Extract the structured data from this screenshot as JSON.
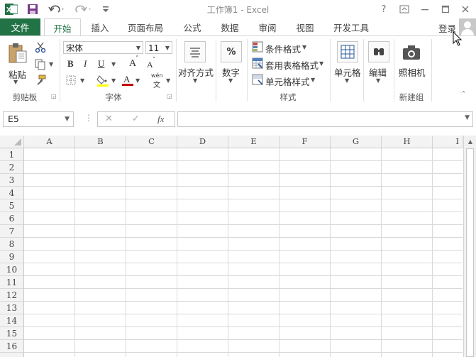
{
  "app": {
    "title": "工作簿1 - Excel",
    "icon": "excel-icon"
  },
  "quick_access": {
    "save_icon": "save-icon",
    "undo_icon": "undo-icon",
    "redo_icon": "redo-icon",
    "customize_icon": "customize-icon"
  },
  "window_controls": {
    "help": "?",
    "ribbon_display_icon": "ribbon-display-icon",
    "minimize_icon": "minimize-icon",
    "maximize_icon": "maximize-icon",
    "close_icon": "close-icon"
  },
  "tabs": {
    "file": "文件",
    "items": [
      "开始",
      "插入",
      "页面布局",
      "公式",
      "数据",
      "审阅",
      "视图",
      "开发工具"
    ],
    "active": "开始",
    "login": "登录"
  },
  "ribbon": {
    "clipboard": {
      "label": "剪贴板",
      "paste": "粘贴"
    },
    "font": {
      "label": "字体",
      "font_name": "宋体",
      "font_size": "11",
      "bold": "B",
      "italic": "I",
      "underline": "U",
      "grow": "A",
      "shrink": "A",
      "phonetic_top": "wén",
      "phonetic_bottom": "文"
    },
    "alignment": {
      "label": "对齐方式"
    },
    "number": {
      "label": "数字",
      "symbol": "%"
    },
    "styles": {
      "label": "样式",
      "conditional": "条件格式",
      "table_format": "套用表格格式",
      "cell_styles": "单元格样式"
    },
    "cells": {
      "label": "单元格"
    },
    "editing": {
      "label": "编辑"
    },
    "camera": {
      "label": "照相机",
      "group": "新建组"
    }
  },
  "formula_bar": {
    "name_box": "E5",
    "cancel": "✕",
    "enter": "✓",
    "fx": "fx",
    "value": ""
  },
  "sheet": {
    "columns": [
      "A",
      "B",
      "C",
      "D",
      "E",
      "F",
      "G",
      "H",
      "I"
    ],
    "rows": [
      "1",
      "2",
      "3",
      "4",
      "5",
      "6",
      "7",
      "8",
      "9",
      "10",
      "11",
      "12",
      "13",
      "14",
      "15",
      "16"
    ]
  },
  "colors": {
    "excel_green": "#217346",
    "accent_blue": "#2b579a",
    "font_color_red": "#c00000",
    "highlight_yellow": "#ffff00"
  }
}
